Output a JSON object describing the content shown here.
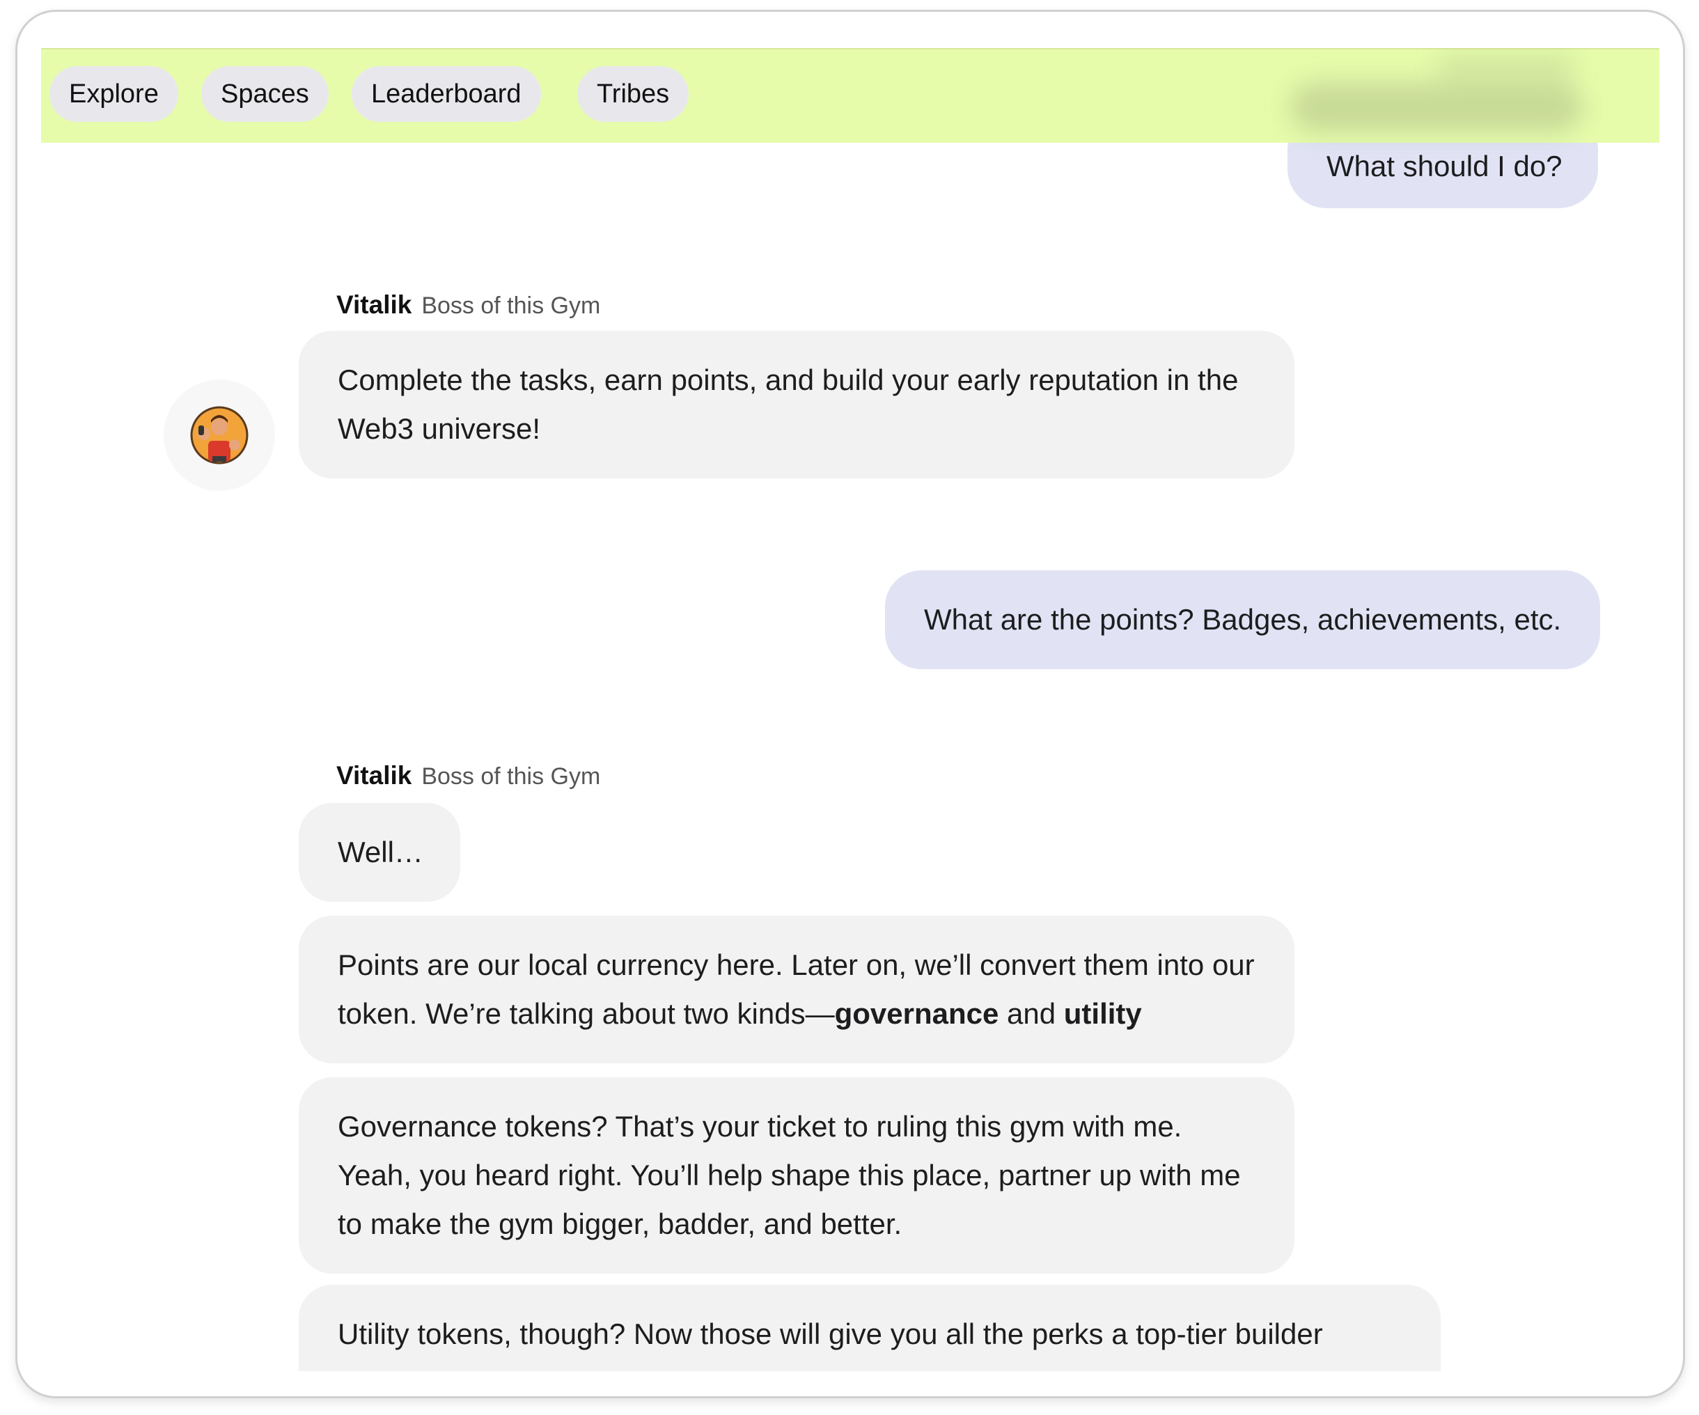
{
  "nav": {
    "tabs": [
      {
        "label": "Explore"
      },
      {
        "label": "Spaces"
      },
      {
        "label": "Leaderboard"
      },
      {
        "label": "Tribes"
      }
    ]
  },
  "conversation": {
    "partial_user_message": "What should I do?",
    "messages": [
      {
        "role": "bot",
        "sender_name": "Vitalik",
        "sender_role": "Boss of this Gym",
        "text": "Complete the tasks, earn points, and build your early reputation in the Web3 universe!"
      },
      {
        "role": "user",
        "text": "What are the points? Badges, achievements, etc."
      },
      {
        "role": "bot",
        "sender_name": "Vitalik",
        "sender_role": "Boss of this Gym",
        "bubbles": [
          {
            "text": "Well…"
          },
          {
            "text_before": "Points are our local currency here. Later on, we’ll convert them into our token. We’re talking about two kinds—",
            "bold_1": "governance",
            "text_middle": " and ",
            "bold_2": "utility"
          },
          {
            "text": "Governance tokens? That’s your ticket to ruling this gym with me. Yeah, you heard right. You’ll help shape this place, partner up with me to make the gym bigger, badder, and better."
          },
          {
            "text": "Utility tokens, though? Now those will give you all the perks a top-tier builder deserves. We’re talking exclusive access to tech events, conferences, discounts"
          }
        ]
      }
    ]
  },
  "colors": {
    "navbar_bg": "#e6fcab",
    "user_bubble": "#e1e3f5",
    "bot_bubble": "#f2f2f2",
    "nav_pill": "#e8e8ec"
  },
  "icons": {
    "avatar": "gym-boss-avatar-icon"
  }
}
